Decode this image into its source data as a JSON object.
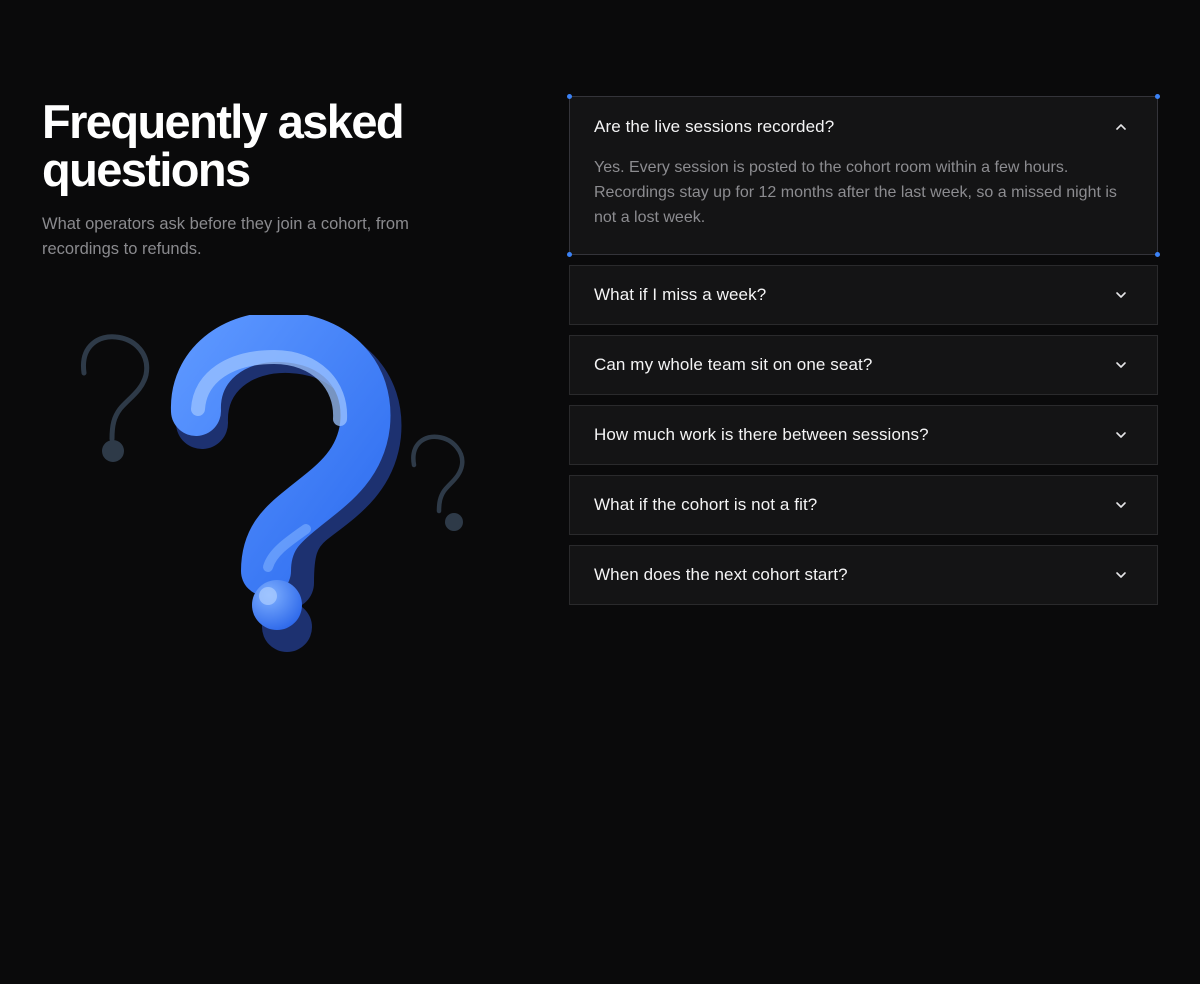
{
  "intro": {
    "title_line1": "Frequently asked",
    "title_line2": "questions",
    "subtitle": "What operators ask before they join a cohort, from recordings to refunds."
  },
  "illustration": {
    "icon": "question-mark-illustration",
    "colors": {
      "main": "#3b7cf5",
      "highlight": "#9cc3ff",
      "shadow": "#1d3170",
      "small_marks": "#2e3a48"
    }
  },
  "faq": {
    "items": [
      {
        "question": "Are the live sessions recorded?",
        "answer": "Yes. Every session is posted to the cohort room within a few hours. Recordings stay up for 12 months after the last week, so a missed night is not a lost week.",
        "expanded": true,
        "icon": "chevron-up-icon"
      },
      {
        "question": "What if I miss a week?",
        "expanded": false,
        "icon": "chevron-down-icon"
      },
      {
        "question": "Can my whole team sit on one seat?",
        "expanded": false,
        "icon": "chevron-down-icon"
      },
      {
        "question": "How much work is there between sessions?",
        "expanded": false,
        "icon": "chevron-down-icon"
      },
      {
        "question": "What if the cohort is not a fit?",
        "expanded": false,
        "icon": "chevron-down-icon"
      },
      {
        "question": "When does the next cohort start?",
        "expanded": false,
        "icon": "chevron-down-icon"
      }
    ]
  },
  "colors": {
    "background": "#0a0a0b",
    "card": "#141415",
    "border": "#2a2a2c",
    "selection_handle": "#3b82f6",
    "muted_text": "#8a8a8e"
  }
}
